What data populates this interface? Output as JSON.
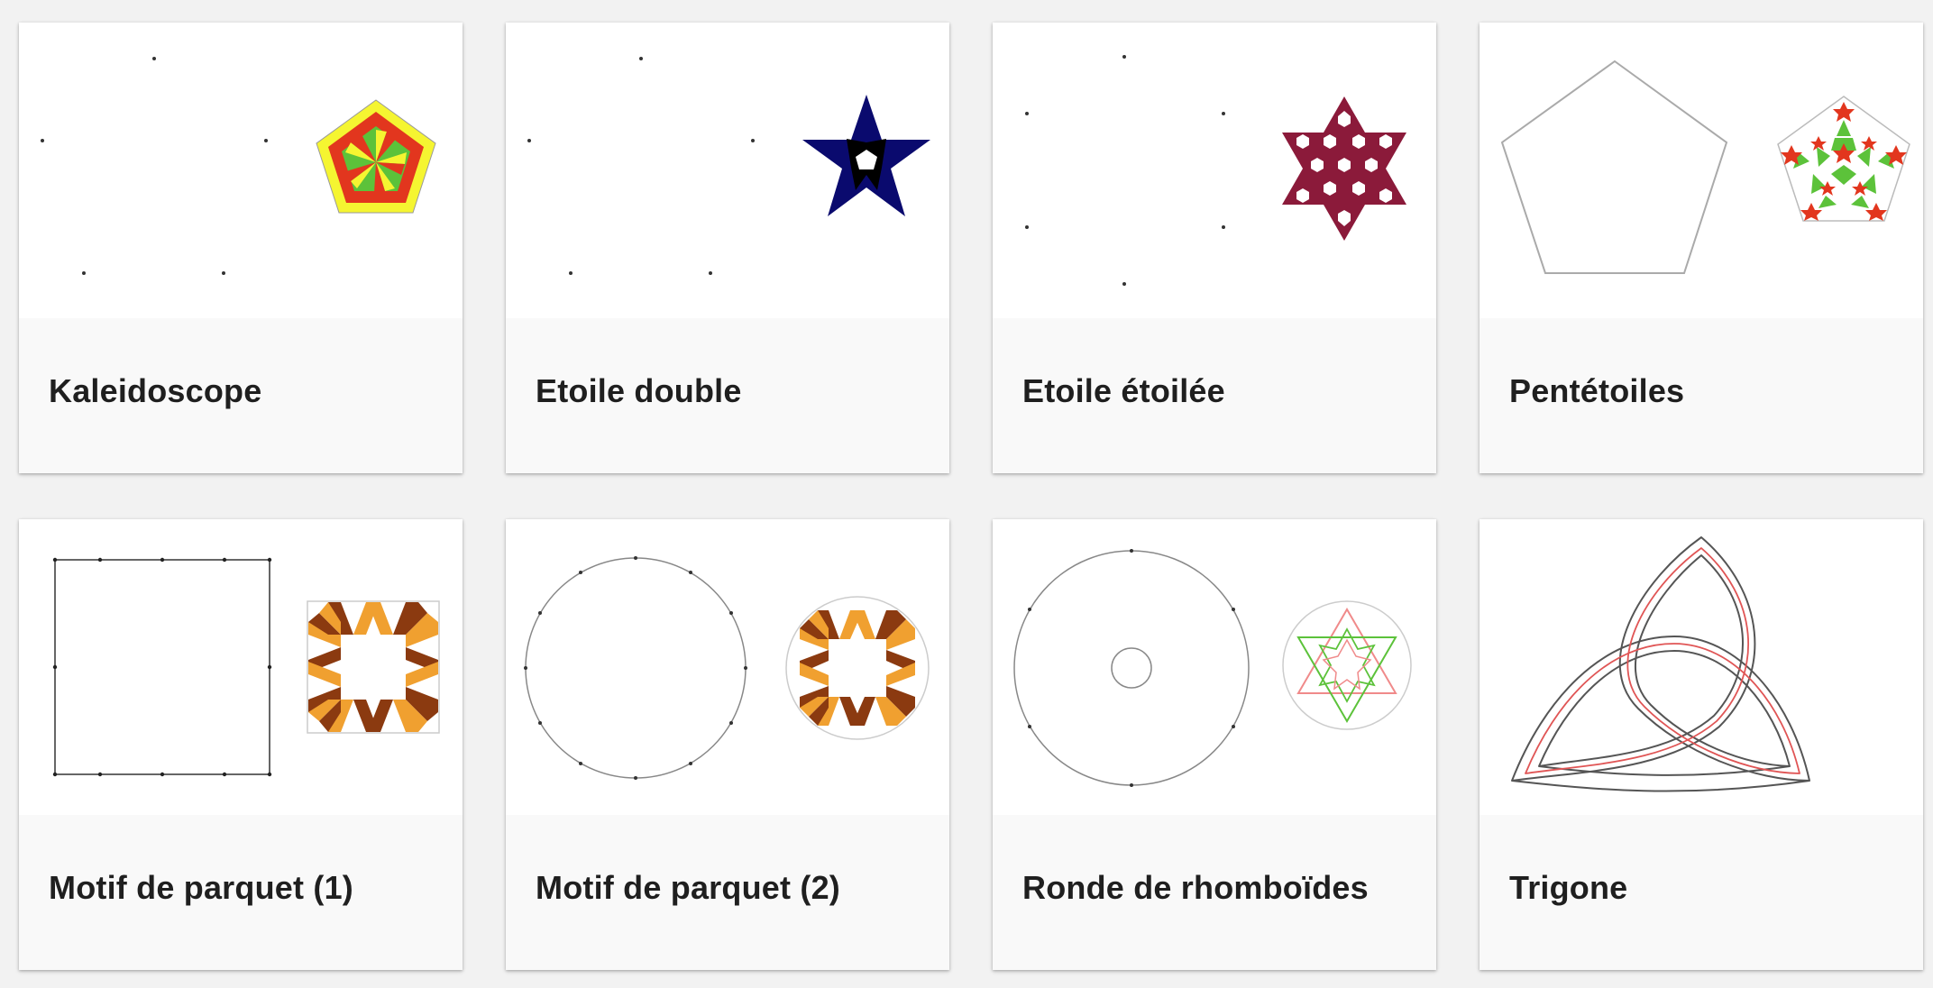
{
  "gallery": {
    "items": [
      {
        "title": "Kaleidoscope"
      },
      {
        "title": "Etoile double"
      },
      {
        "title": "Etoile étoilée"
      },
      {
        "title": "Pentétoiles"
      },
      {
        "title": "Motif de parquet (1)"
      },
      {
        "title": "Motif de parquet (2)"
      },
      {
        "title": "Ronde de rhomboïdes"
      },
      {
        "title": "Trigone"
      }
    ]
  },
  "colors": {
    "yellow": "#f5f531",
    "red": "#e2361e",
    "green": "#5cc23a",
    "navy": "#0a0a6e",
    "maroon": "#8b1a3a",
    "brown": "#8b3a10",
    "orange": "#f0a030",
    "celtic_red": "#f08a8a"
  }
}
